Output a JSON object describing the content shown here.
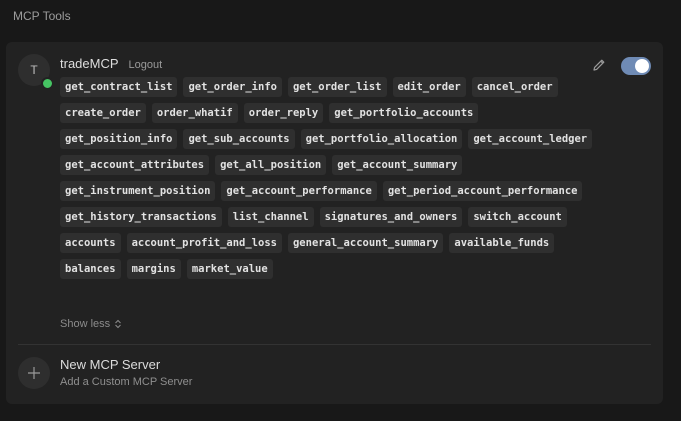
{
  "page": {
    "title": "MCP Tools"
  },
  "server": {
    "avatar_letter": "T",
    "name": "tradeMCP",
    "logout_label": "Logout",
    "enabled": true,
    "status_color": "#46c463",
    "toggle_color": "#6f8bb5",
    "tools": [
      "get_contract_list",
      "get_order_info",
      "get_order_list",
      "edit_order",
      "cancel_order",
      "create_order",
      "order_whatif",
      "order_reply",
      "get_portfolio_accounts",
      "get_position_info",
      "get_sub_accounts",
      "get_portfolio_allocation",
      "get_account_ledger",
      "get_account_attributes",
      "get_all_position",
      "get_account_summary",
      "get_instrument_position",
      "get_account_performance",
      "get_period_account_performance",
      "get_history_transactions",
      "list_channel",
      "signatures_and_owners",
      "switch_account",
      "accounts",
      "account_profit_and_loss",
      "general_account_summary",
      "available_funds",
      "balances",
      "margins",
      "market_value"
    ],
    "show_less_label": "Show less",
    "icons": {
      "edit": "pencil-icon",
      "show_less": "chevron-updown-icon"
    }
  },
  "add_server": {
    "title": "New MCP Server",
    "subtitle": "Add a Custom MCP Server",
    "icon": "plus-icon"
  }
}
